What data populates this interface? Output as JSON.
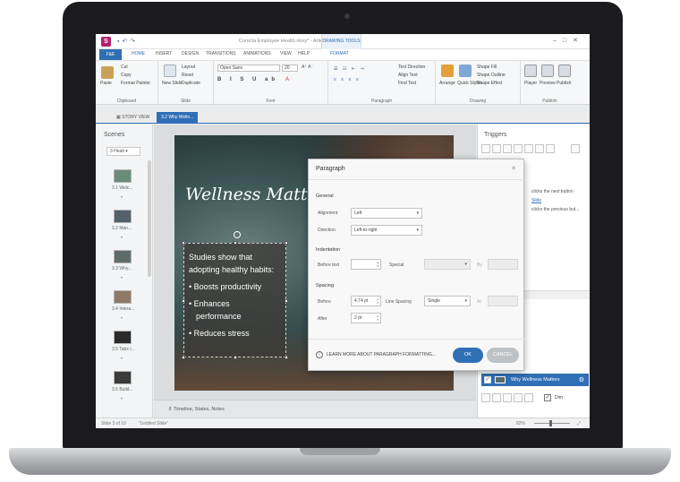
{
  "window": {
    "title": "Corecta Employee Health.story* - Articulate Storyline 2",
    "contextual_tab_group": "DRAWING TOOLS",
    "qat_icons": [
      "save-icon",
      "undo-icon",
      "redo-icon"
    ]
  },
  "ribbon_tabs": [
    "F&E",
    "HOME",
    "INSERT",
    "DESIGN",
    "TRANSITIONS",
    "ANIMATIONS",
    "VIEW",
    "HELP",
    "FORMAT"
  ],
  "active_ribbon_tab": "HOME",
  "ribbon": {
    "clipboard": {
      "label": "Clipboard",
      "paste": "Paste",
      "cut": "Cut",
      "copy": "Copy",
      "format_painter": "Format Painter"
    },
    "slide": {
      "label": "Slide",
      "new_slide": "New Slide",
      "layout": "Layout",
      "reset": "Reset",
      "duplicate": "Duplicate"
    },
    "font": {
      "label": "Font",
      "font_name": "Open Sans",
      "font_size": "20"
    },
    "paragraph": {
      "label": "Paragraph",
      "text_direction": "Text Direction",
      "align_text": "Align Text",
      "find_text": "Find Text"
    },
    "drawing": {
      "label": "Drawing",
      "arrange": "Arrange",
      "quick_styles": "Quick Styles",
      "shape_fill": "Shape Fill",
      "shape_outline": "Shape Outline",
      "shape_effect": "Shape Effect"
    },
    "publish": {
      "label": "Publish",
      "player": "Player",
      "preview": "Preview",
      "publish": "Publish"
    }
  },
  "view_tabs": [
    {
      "label": "STORY VIEW",
      "active": false
    },
    {
      "label": "3.2 Why Welln...",
      "active": true
    }
  ],
  "scenes": {
    "title": "Scenes",
    "selected_scene": "3 Healt",
    "thumbs": [
      {
        "label": "3.1 Welc...",
        "color": "#6b8b7a"
      },
      {
        "label": "3.2 Man...",
        "color": "#53616a"
      },
      {
        "label": "3.3 Why...",
        "color": "#5d6c68"
      },
      {
        "label": "3.4 Intera...",
        "color": "#8f7a68"
      },
      {
        "label": "3.5 Tabs I...",
        "color": "#2a2a2a"
      },
      {
        "label": "3.6 Build...",
        "color": "#3b3b3b"
      }
    ]
  },
  "slide": {
    "title": "Wellness Matte",
    "body_lines": [
      "Studies show that",
      "adopting healthy habits:",
      "• Boosts productivity",
      "• Enhances",
      "performance",
      "• Reduces stress"
    ]
  },
  "timeline_label": "Timeline, States, Notes",
  "paragraph_dialog": {
    "title": "Paragraph",
    "general_heading": "General",
    "alignment_label": "Alignment",
    "alignment_value": "Left",
    "direction_label": "Direction",
    "direction_value": "Left-to-right",
    "indentation_heading": "Indentation",
    "before_text_label": "Before text",
    "special_label": "Special",
    "by_label": "By",
    "spacing_heading": "Spacing",
    "before_label": "Before",
    "before_value": "4,74 pt",
    "line_spacing_label": "Line Spacing",
    "line_spacing_value": "Single",
    "at_label": "At",
    "after_label": "After",
    "after_value": "2 pt",
    "learn_more": "LEARN MORE ABOUT PARAGRAPH FORMATTING...",
    "ok": "OK",
    "cancel": "CANCEL"
  },
  "triggers": {
    "title": "Triggers",
    "lines": [
      {
        "text": "clicks the next button",
        "link": false
      },
      {
        "text": "Slide",
        "link": true
      },
      {
        "text": "clicks the previous but...",
        "link": false
      }
    ],
    "selected_layer": "Why Wellness Matters",
    "dim_label": "Dim"
  },
  "status": {
    "slide": "Slide 3 of 10",
    "slide_name": "\"Untitled Slide\"",
    "zoom": "82%"
  }
}
